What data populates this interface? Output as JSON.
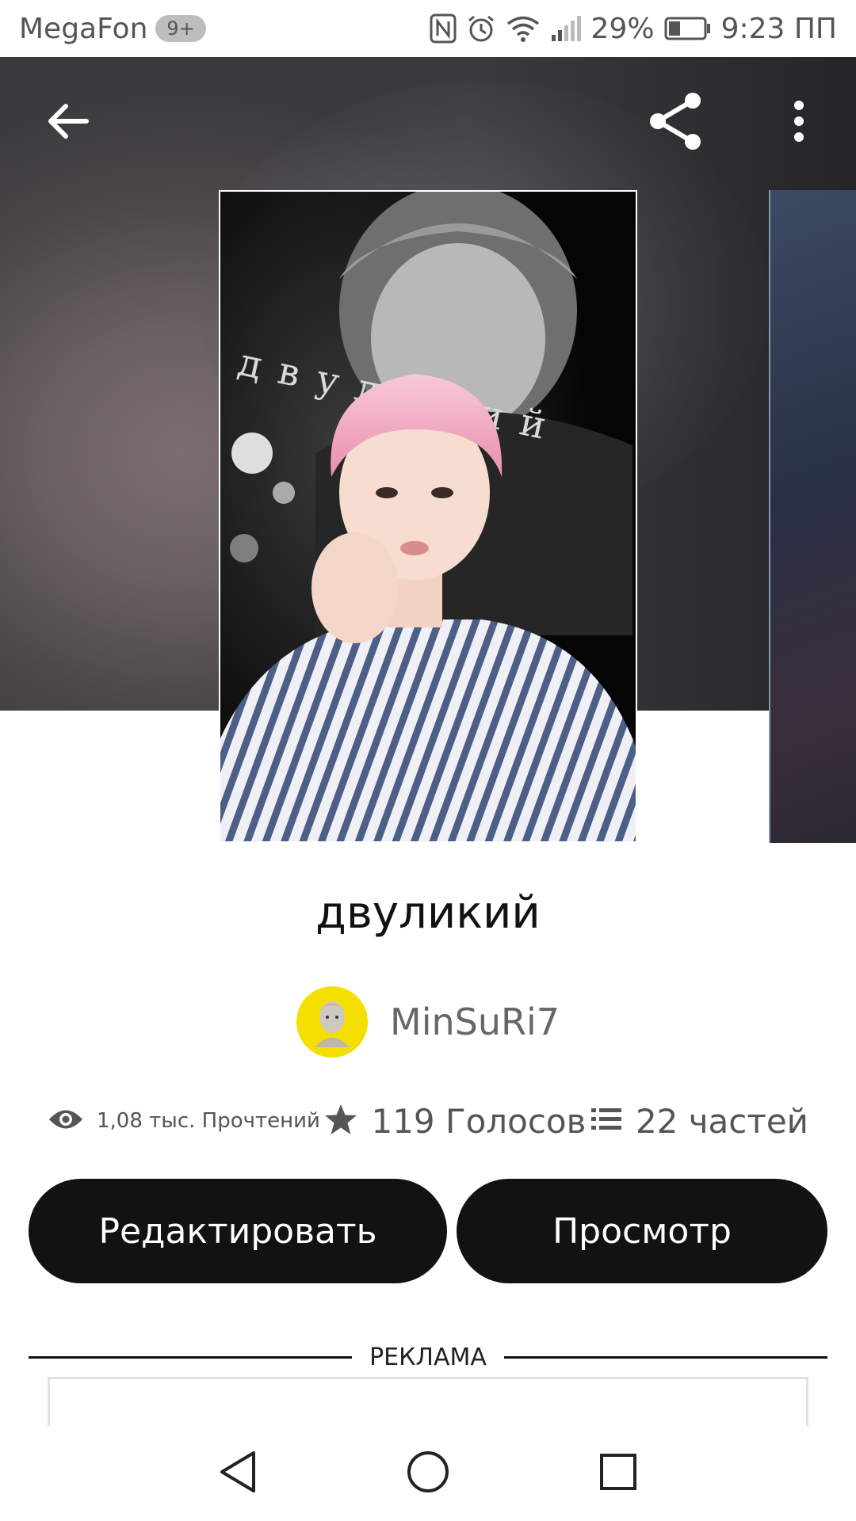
{
  "status_bar": {
    "carrier": "MegaFon",
    "sim_badge": "9+",
    "battery_percent": "29%",
    "time": "9:23 ПП",
    "icons": [
      "nfc-icon",
      "alarm-icon",
      "wifi-icon",
      "signal-icon",
      "battery-icon"
    ]
  },
  "toolbar": {
    "icons": [
      "back-arrow-icon",
      "share-icon",
      "more-vertical-icon"
    ]
  },
  "cover": {
    "overlay_text": "двуликий"
  },
  "story": {
    "title": "двуликий",
    "author": "MinSuRi7"
  },
  "stats": {
    "reads": "1,08 тыс. Прочтений",
    "votes": "119 Голосов",
    "parts": "22 частей",
    "icons": [
      "eye-icon",
      "star-icon",
      "list-icon"
    ]
  },
  "actions": {
    "edit_label": "Редактировать",
    "view_label": "Просмотр"
  },
  "ad": {
    "label": "РЕКЛАМА"
  },
  "nav_bar": {
    "icons": [
      "back-triangle-icon",
      "home-circle-icon",
      "recents-square-icon"
    ]
  },
  "colors": {
    "button_bg": "#121212",
    "avatar_bg": "#f4e000",
    "header_bg": "#4a4749"
  }
}
